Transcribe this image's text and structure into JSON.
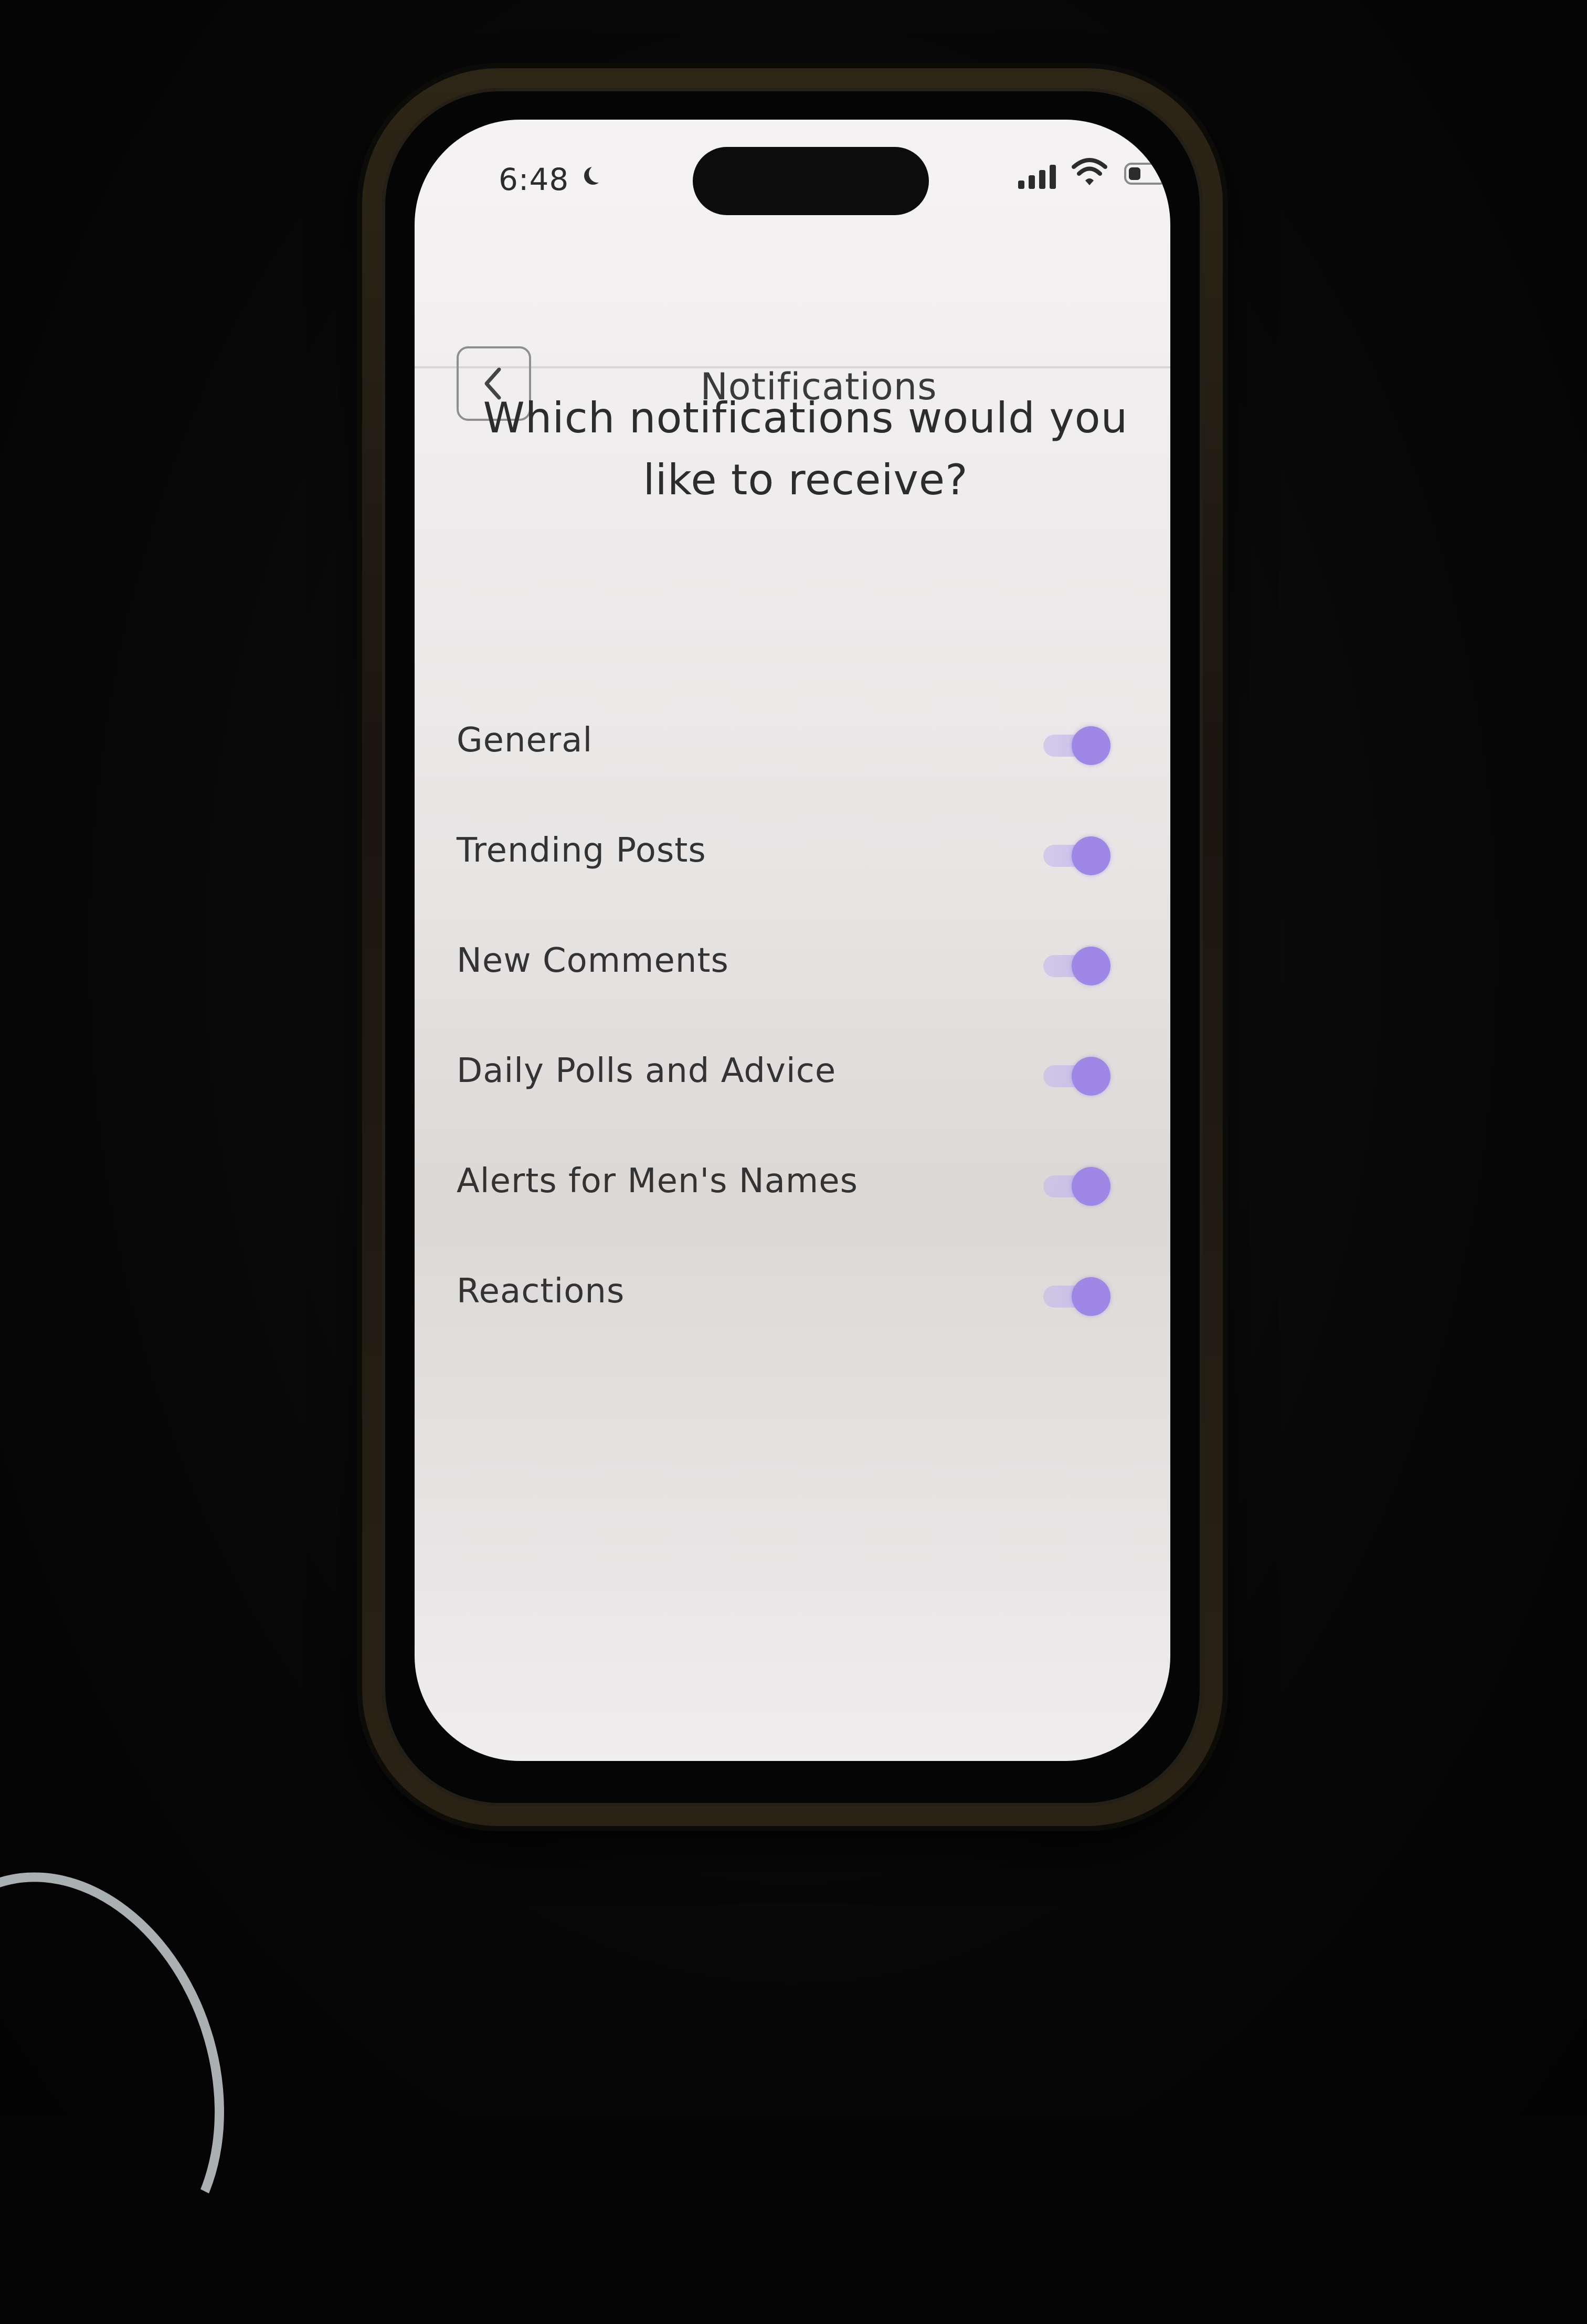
{
  "status_bar": {
    "time": "6:48",
    "icons": [
      "moon-icon",
      "signal-icon",
      "wifi-icon",
      "battery-icon"
    ]
  },
  "header": {
    "title": "Notifications",
    "back_icon": "chevron-left-icon"
  },
  "question": {
    "line1": "Which notifications would you",
    "line2": "like to receive?"
  },
  "settings": [
    {
      "label": "General",
      "enabled": true
    },
    {
      "label": "Trending Posts",
      "enabled": true
    },
    {
      "label": "New Comments",
      "enabled": true
    },
    {
      "label": "Daily Polls and Advice",
      "enabled": true
    },
    {
      "label": "Alerts for Men's Names",
      "enabled": true
    },
    {
      "label": "Reactions",
      "enabled": true
    }
  ],
  "colors": {
    "accent": "#9d88e6",
    "toggle_track": "#c8bcee",
    "text": "#333333",
    "screen_bg": "#f5f3f4"
  }
}
